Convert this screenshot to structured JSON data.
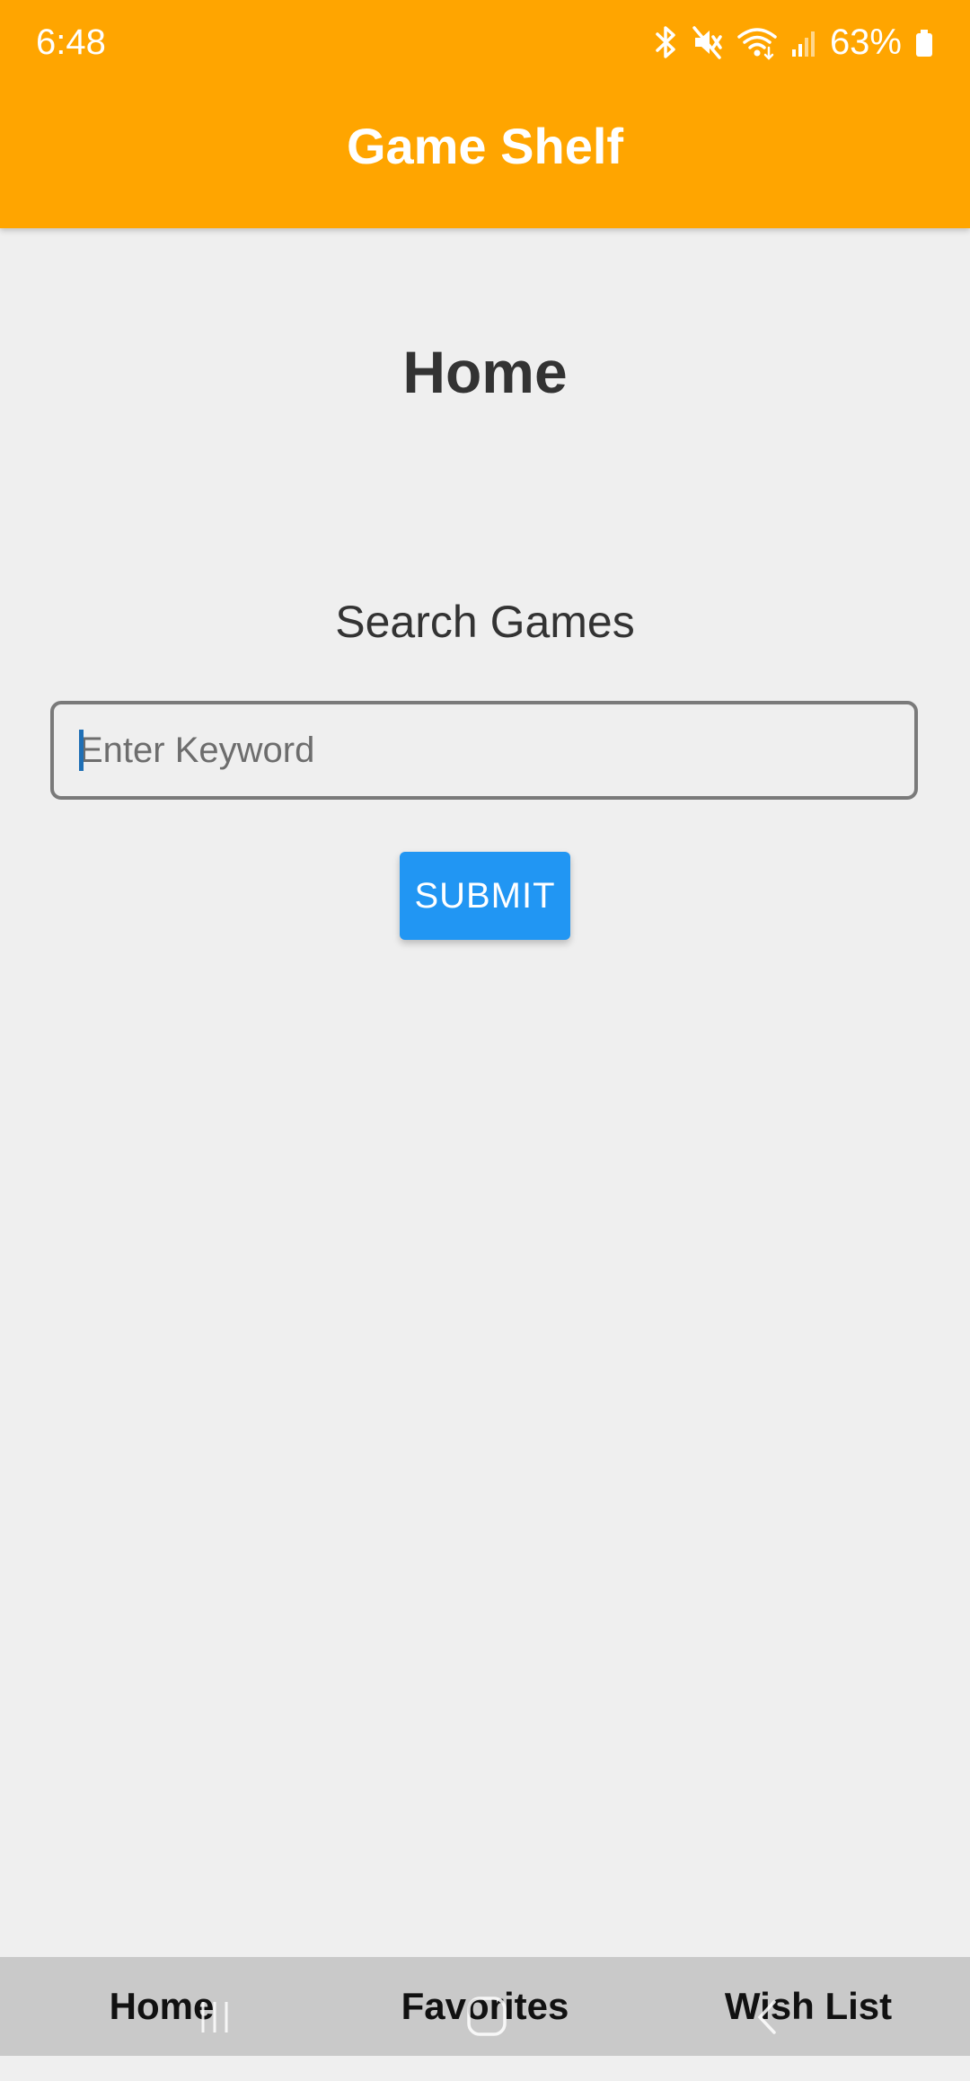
{
  "status_bar": {
    "time": "6:48",
    "battery": "63%",
    "icons": [
      "bluetooth-icon",
      "mute-icon",
      "wifi-icon",
      "signal-icon",
      "battery-icon"
    ]
  },
  "app_bar": {
    "title": "Game Shelf",
    "color": "#FFA500"
  },
  "main": {
    "heading": "Home",
    "search_label": "Search Games",
    "search_placeholder": "Enter Keyword",
    "search_value": "",
    "submit_label": "SUBMIT",
    "submit_color": "#2196F3"
  },
  "bottom_nav": {
    "items": [
      {
        "label": "Home"
      },
      {
        "label": "Favorites"
      },
      {
        "label": "Wish List"
      }
    ]
  },
  "system_nav": {
    "icons": [
      "recents-icon",
      "home-icon",
      "back-icon"
    ]
  }
}
